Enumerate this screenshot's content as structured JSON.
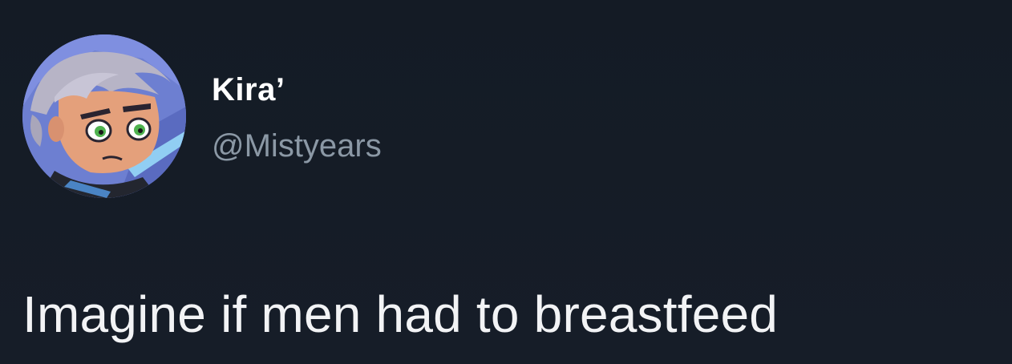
{
  "tweet": {
    "author": {
      "display_name": "Kira’",
      "handle": "@Mistyears",
      "avatar_icon": "cartoon-character-avatar-icon"
    },
    "text": "Imagine if men had to breastfeed"
  },
  "colors": {
    "background": "#151c26",
    "display_name": "#ffffff",
    "handle": "#8b98a5",
    "text": "#f2f3f5"
  }
}
